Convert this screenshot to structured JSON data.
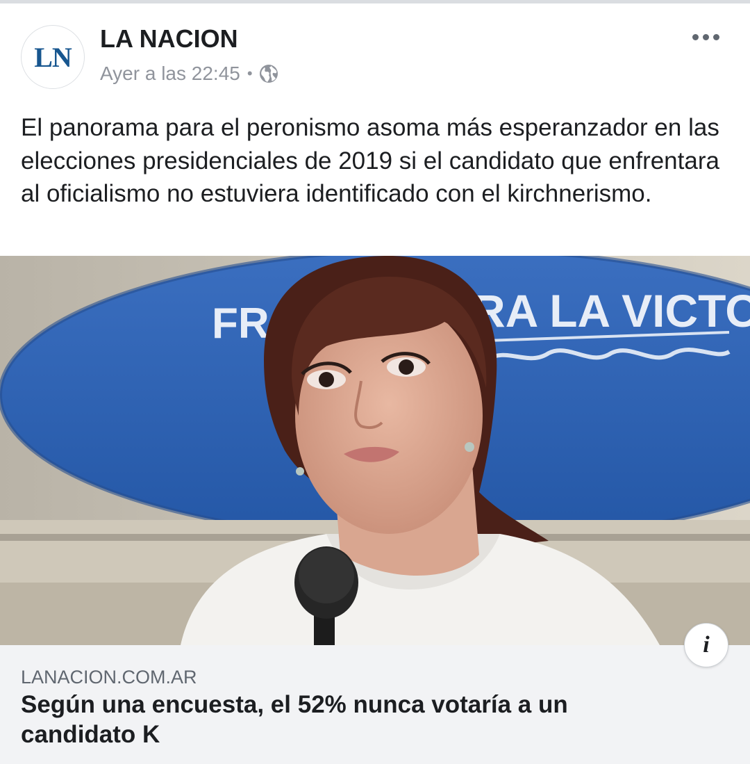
{
  "post": {
    "page_name": "LA NACION",
    "avatar_text": "LN",
    "timestamp": "Ayer a las 22:45",
    "separator": "•",
    "privacy_icon": "globe-icon",
    "more_icon": "more-dots-icon",
    "text": "El panorama para el peronismo asoma más esperanzador en las elecciones presidenciales de 2019 si el candidato que enfrentara al oficialismo no estuviera identificado con el kirchnerismo."
  },
  "photo": {
    "banner_text_left": "FR",
    "banner_text_right": "RA LA VICTO"
  },
  "link": {
    "domain": "LANACION.COM.AR",
    "title": "Según una encuesta, el 52% nunca votaría a un candidato K",
    "info_icon": "info-icon",
    "info_glyph": "i"
  },
  "colors": {
    "brand_logo": "#17568f",
    "text_primary": "#1c1e21",
    "text_secondary": "#90949c",
    "link_bg": "#f2f3f5",
    "banner_blue": "#2f63b5"
  }
}
